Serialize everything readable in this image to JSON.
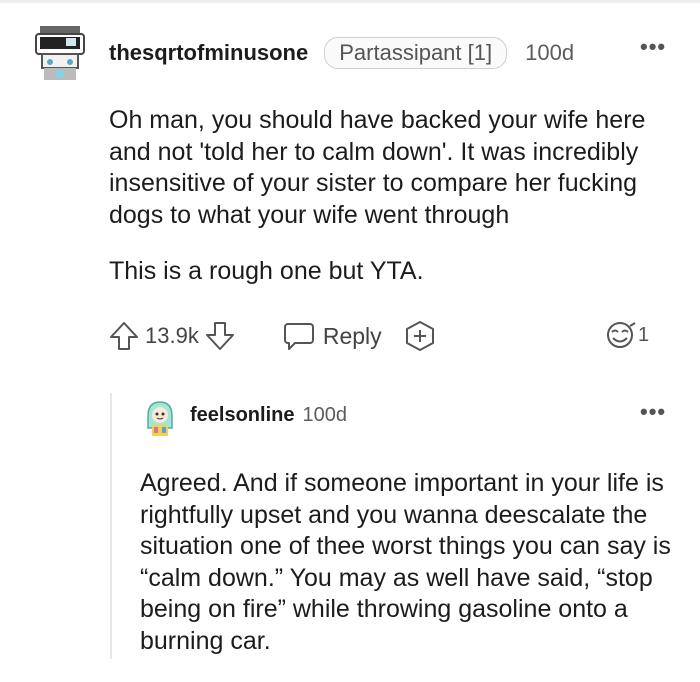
{
  "comment": {
    "username": "thesqrtofminusone",
    "flair": "Partassipant [1]",
    "age": "100d",
    "more": "•••",
    "body_paragraph_1": "Oh man, you should have backed your wife here and not 'told her to calm down'. It was incredibly insensitive of your sister to compare her fucking dogs to what your wife went through",
    "body_paragraph_2": "This is a rough one but YTA.",
    "score": "13.9k",
    "reply_label": "Reply",
    "award_count": "1"
  },
  "reply": {
    "username": "feelsonline",
    "age": "100d",
    "more": "•••",
    "body": "Agreed. And if someone important in your life is rightfully upset and you wanna deescalate the situation one of thee worst things you can say is “calm down.” You may as well have said, “stop being on fire” while throwing gasoline onto a burning car."
  },
  "icons": [
    "avatar-robot-icon",
    "upvote-icon",
    "downvote-icon",
    "reply-icon",
    "award-icon",
    "emoji-award-icon",
    "avatar-girl-icon",
    "more-icon"
  ],
  "colors": {
    "text": "#1c1c1c",
    "meta": "#5c5c5c",
    "border": "#cfcfcf",
    "thread": "#e6e6e6"
  }
}
